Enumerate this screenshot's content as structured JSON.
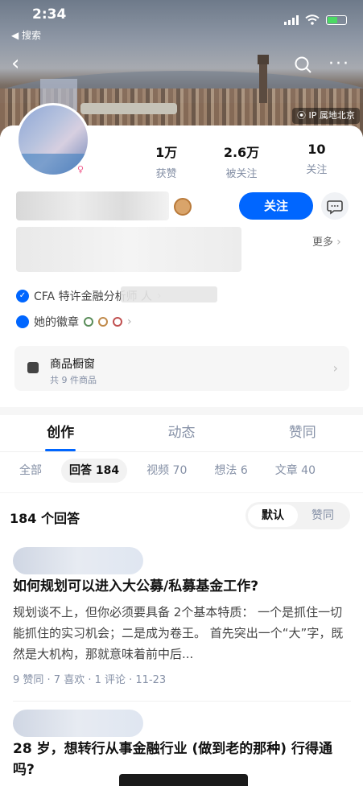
{
  "status": {
    "time": "2:34",
    "back_label": "◀ 搜索"
  },
  "header": {
    "ip_label": "IP 属地北京"
  },
  "profile": {
    "stats": [
      {
        "value": "1万",
        "label": "获赞"
      },
      {
        "value": "2.6万",
        "label": "被关注"
      },
      {
        "value": "10",
        "label": "关注"
      }
    ],
    "follow_label": "关注",
    "more_label": "更多",
    "cert_label": "CFA 特许金融分析师 人",
    "badges_label": "她的徽章",
    "shop": {
      "title": "商品橱窗",
      "subtitle": "共 9 件商品"
    }
  },
  "tabs": [
    "创作",
    "动态",
    "赞同"
  ],
  "subtabs": [
    "全部",
    "回答 184",
    "视频 70",
    "想法 6",
    "文章 40"
  ],
  "list": {
    "count_label": "184 个回答",
    "sort": [
      "默认",
      "赞同"
    ],
    "items": [
      {
        "title": "如何规划可以进入大公募/私募基金工作?",
        "excerpt": "规划谈不上，但你必须要具备 2个基本特质： 一个是抓住一切能抓住的实习机会；二是成为卷王。 首先突出一个“大”字，既然是大机构，那就意味着前中后...",
        "meta": "9 赞同 · 7 喜欢 · 1 评论 · 11-23"
      },
      {
        "title": "28 岁，想转行从事金融行业 (做到老的那种) 行得通吗?"
      }
    ]
  },
  "colors": {
    "accent": "#0066ff",
    "muted": "#8590a6"
  }
}
